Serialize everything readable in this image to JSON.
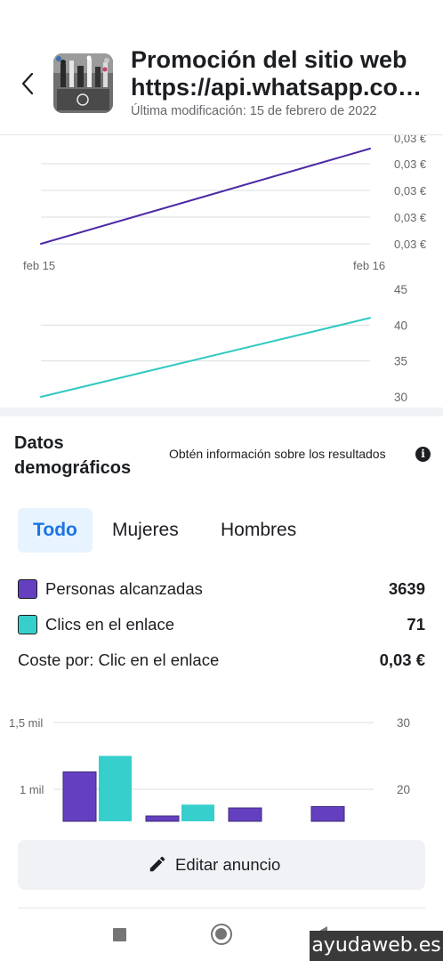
{
  "header": {
    "title_line1": "Promoción del sitio web",
    "title_line2": "https://api.whatsapp.co…",
    "subtitle": "Última modificación: 15 de febrero de 2022",
    "back_icon": "chevron-left-icon"
  },
  "chart_data": [
    {
      "type": "line",
      "x": [
        "feb 15",
        "feb 16"
      ],
      "series": [
        {
          "values": [
            0.03,
            0.03
          ],
          "color": "#4c2aa5"
        }
      ],
      "y_tick_labels": [
        "0,03 €",
        "0,03 €",
        "0,03 €",
        "0,03 €",
        "0,03 €"
      ],
      "grid": true
    },
    {
      "type": "line",
      "x": [
        "feb 15",
        "feb 16"
      ],
      "series": [
        {
          "values": [
            30,
            41
          ],
          "color": "#2ec9c2"
        }
      ],
      "y_tick_labels": [
        "45",
        "40",
        "35",
        "30"
      ],
      "ylim": [
        30,
        45
      ],
      "grid": true
    },
    {
      "type": "bar",
      "series": [
        {
          "color": "#6440c0",
          "values": [
            1.13,
            0.8,
            0.86,
            0.87
          ]
        },
        {
          "color": "#37cfcb",
          "values": [
            25,
            17.7
          ]
        }
      ],
      "left_axis_labels": [
        "1,5 mil",
        "1 mil"
      ],
      "right_axis_labels": [
        "30",
        "20"
      ],
      "grid": true
    }
  ],
  "demographics": {
    "title": "Datos demográficos",
    "info_link": "Obtén información sobre los resultados",
    "info_icon": "info-icon",
    "tabs": [
      "Todo",
      "Mujeres",
      "Hombres"
    ],
    "active_tab": "Todo",
    "metrics": [
      {
        "label": "Personas alcanzadas",
        "value": "3639",
        "color": "#6440c0"
      },
      {
        "label": "Clics en el enlace",
        "value": "71",
        "color": "#37cfcb"
      }
    ],
    "cost_label": "Coste por: Clic en el enlace",
    "cost_value": "0,03 €"
  },
  "actions": {
    "edit_label": "Editar anuncio",
    "edit_icon": "pencil-icon"
  },
  "nav": {
    "recents_icon": "square-icon",
    "home_icon": "circle-icon",
    "back_icon": "triangle-back-icon"
  },
  "watermark": "ayudaweb.es"
}
